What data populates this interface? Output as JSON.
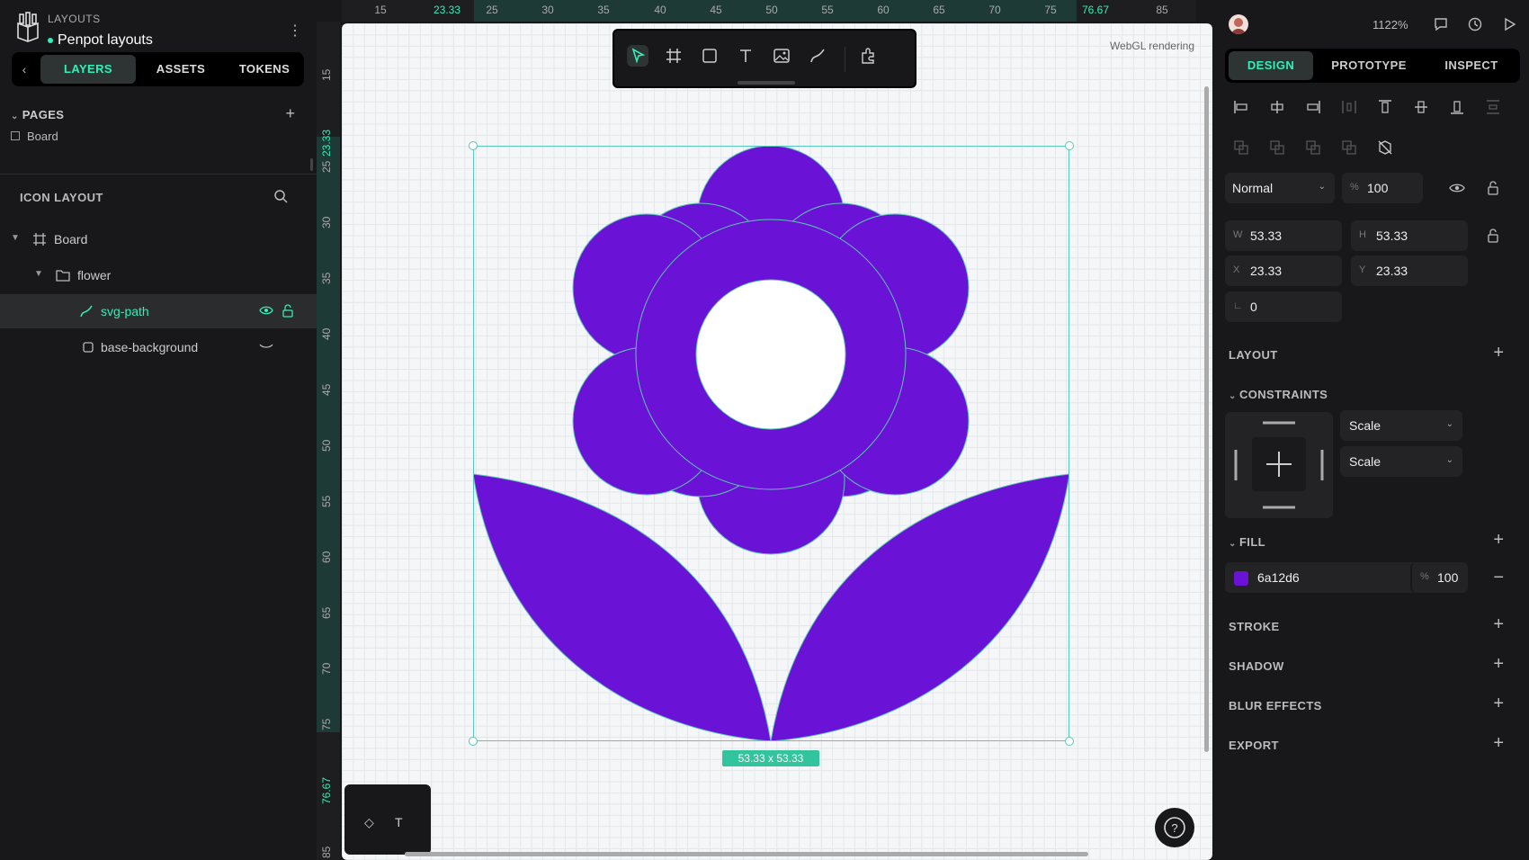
{
  "project": {
    "team": "LAYOUTS",
    "name": "Penpot layouts"
  },
  "left_tabs": [
    "LAYERS",
    "ASSETS",
    "TOKENS"
  ],
  "pages": {
    "header": "PAGES",
    "items": [
      "Board"
    ]
  },
  "layers": {
    "header": "ICON LAYOUT",
    "items": [
      {
        "label": "Board"
      },
      {
        "label": "flower"
      },
      {
        "label": "svg-path"
      },
      {
        "label": "base-background"
      }
    ]
  },
  "ruler_top": [
    "15",
    "23.33",
    "25",
    "30",
    "35",
    "40",
    "45",
    "50",
    "55",
    "60",
    "65",
    "70",
    "75",
    "76.67",
    "85"
  ],
  "ruler_left": [
    "15",
    "23.33",
    "25",
    "30",
    "35",
    "40",
    "45",
    "50",
    "55",
    "60",
    "65",
    "70",
    "75",
    "76.67",
    "85"
  ],
  "canvas": {
    "webgl_label": "WebGL rendering",
    "size_badge": "53.33 x 53.33",
    "flower_color": "#6a12d6",
    "selection_color": "#5ac8b6"
  },
  "toolbar_icons": [
    "pointer-icon",
    "board-icon",
    "rectangle-icon",
    "text-icon",
    "image-icon",
    "path-icon",
    "plugins-icon"
  ],
  "right": {
    "zoom": "1122%",
    "tabs": [
      "DESIGN",
      "PROTOTYPE",
      "INSPECT"
    ],
    "blend": "Normal",
    "opacity": "100",
    "w_label": "W",
    "w": "53.33",
    "h_label": "H",
    "h": "53.33",
    "x_label": "X",
    "x": "23.33",
    "y_label": "Y",
    "y": "23.33",
    "rotation": "0",
    "sections": {
      "layout": "LAYOUT",
      "constraints": "CONSTRAINTS",
      "fill": "FILL",
      "stroke": "STROKE",
      "shadow": "SHADOW",
      "blur": "BLUR EFFECTS",
      "export": "EXPORT"
    },
    "constraint_h": "Scale",
    "constraint_v": "Scale",
    "fill_hex": "6a12d6",
    "fill_opacity": "100",
    "percent": "%"
  }
}
